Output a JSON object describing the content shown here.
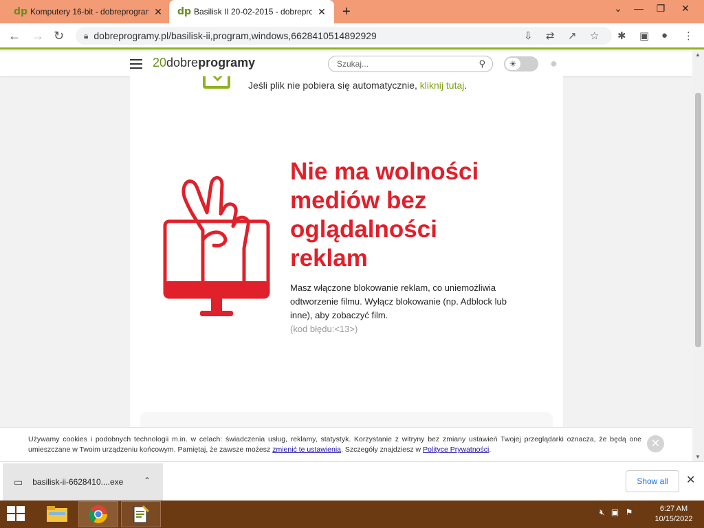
{
  "browser": {
    "tabs": [
      {
        "favicon": "dp",
        "title": "Komputery 16-bit - dobreprogramy",
        "close": "✕"
      },
      {
        "favicon": "dp",
        "title": "Basilisk II 20-02-2015 - dobreprogramy",
        "close": "✕"
      }
    ],
    "new_tab": "+",
    "url": "dobreprogramy.pl/basilisk-ii,program,windows,6628410514892929"
  },
  "site": {
    "logo_num": "20",
    "logo_light": "dobre",
    "logo_bold": "programy",
    "search_placeholder": "Szukaj..."
  },
  "content": {
    "download_note": "Jeśli plik nie pobiera się automatycznie, ",
    "download_link": "kliknij tutaj",
    "download_note_end": ".",
    "headline": "Nie ma wolności mediów bez oglądalności reklam",
    "body": "Masz włączone blokowanie reklam, co uniemożliwia odtworzenie filmu. Wyłącz blokowanie (np. Adblock lub inne), aby zobaczyć film.",
    "error_code": "(kod błędu:<13>)",
    "accent_color": "#e0202a",
    "link_color": "#7fa012"
  },
  "cookie": {
    "text_1": "Używamy cookies i podobnych technologii m.in. w celach: świadczenia usług, reklamy, statystyk. Korzystanie z witryny bez zmiany ustawień Twojej przeglądarki oznacza, że będą one umieszczane w Twoim urządzeniu końcowym. Pamiętaj, że zawsze możesz ",
    "link_1": "zmienić te ustawienia",
    "text_2": ". Szczegóły znajdziesz w ",
    "link_2": "Polityce Prywatności",
    "text_3": ".",
    "close": "✕"
  },
  "downloads": {
    "file": "basilisk-ii-6628410....exe",
    "show_all": "Show all",
    "close": "✕"
  },
  "taskbar": {
    "time": "6:27 AM",
    "date": "10/15/2022"
  }
}
